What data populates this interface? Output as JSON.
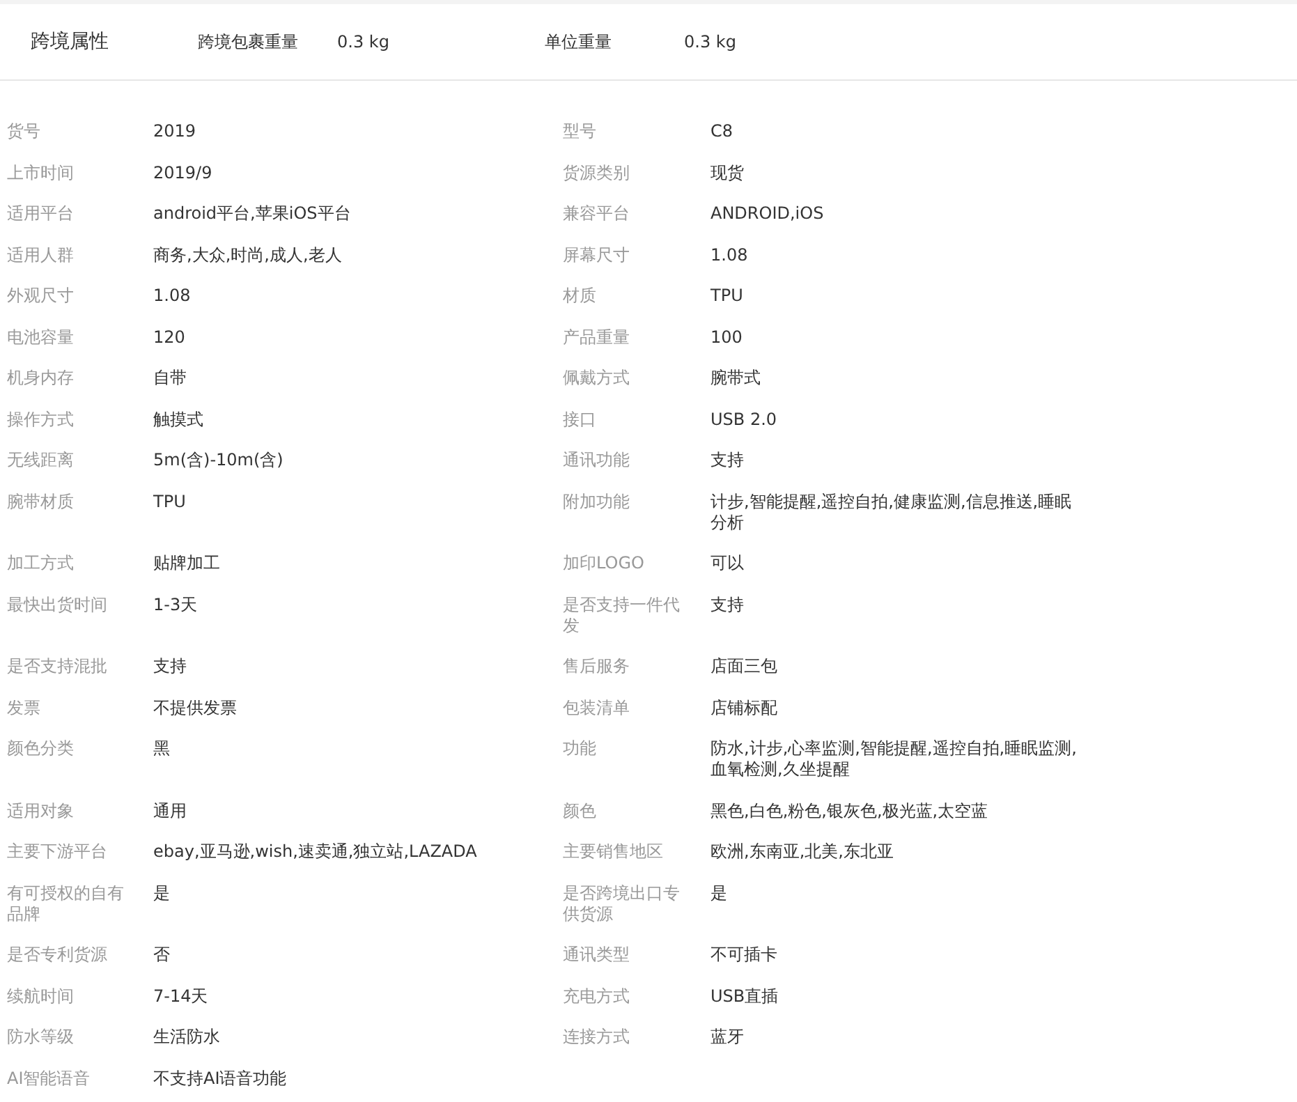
{
  "section": {
    "title": "跨境属性",
    "fields": [
      {
        "label": "跨境包裹重量",
        "value": "0.3 kg"
      },
      {
        "label": "单位重量",
        "value": "0.3 kg"
      }
    ]
  },
  "attributes": [
    {
      "left": {
        "label": "货号",
        "value": "2019"
      },
      "right": {
        "label": "型号",
        "value": "C8"
      }
    },
    {
      "left": {
        "label": "上市时间",
        "value": "2019/9"
      },
      "right": {
        "label": "货源类别",
        "value": "现货"
      }
    },
    {
      "left": {
        "label": "适用平台",
        "value": "android平台,苹果iOS平台"
      },
      "right": {
        "label": "兼容平台",
        "value": "ANDROID,iOS"
      }
    },
    {
      "left": {
        "label": "适用人群",
        "value": "商务,大众,时尚,成人,老人"
      },
      "right": {
        "label": "屏幕尺寸",
        "value": "1.08"
      }
    },
    {
      "left": {
        "label": "外观尺寸",
        "value": "1.08"
      },
      "right": {
        "label": "材质",
        "value": "TPU"
      }
    },
    {
      "left": {
        "label": "电池容量",
        "value": "120"
      },
      "right": {
        "label": "产品重量",
        "value": "100"
      }
    },
    {
      "left": {
        "label": "机身内存",
        "value": "自带"
      },
      "right": {
        "label": "佩戴方式",
        "value": "腕带式"
      }
    },
    {
      "left": {
        "label": "操作方式",
        "value": "触摸式"
      },
      "right": {
        "label": "接口",
        "value": "USB 2.0"
      }
    },
    {
      "left": {
        "label": "无线距离",
        "value": "5m(含)-10m(含)"
      },
      "right": {
        "label": "通讯功能",
        "value": "支持"
      }
    },
    {
      "left": {
        "label": "腕带材质",
        "value": "TPU"
      },
      "right": {
        "label": "附加功能",
        "value": "计步,智能提醒,遥控自拍,健康监测,信息推送,睡眠分析"
      }
    },
    {
      "left": {
        "label": "加工方式",
        "value": "贴牌加工"
      },
      "right": {
        "label": "加印LOGO",
        "value": "可以"
      }
    },
    {
      "left": {
        "label": "最快出货时间",
        "value": "1-3天"
      },
      "right": {
        "label": "是否支持一件代发",
        "value": "支持"
      }
    },
    {
      "left": {
        "label": "是否支持混批",
        "value": "支持"
      },
      "right": {
        "label": "售后服务",
        "value": "店面三包"
      }
    },
    {
      "left": {
        "label": "发票",
        "value": "不提供发票"
      },
      "right": {
        "label": "包装清单",
        "value": "店铺标配"
      }
    },
    {
      "left": {
        "label": "颜色分类",
        "value": "黑"
      },
      "right": {
        "label": "功能",
        "value": "防水,计步,心率监测,智能提醒,遥控自拍,睡眠监测,血氧检测,久坐提醒"
      }
    },
    {
      "left": {
        "label": "适用对象",
        "value": "通用"
      },
      "right": {
        "label": "颜色",
        "value": "黑色,白色,粉色,银灰色,极光蓝,太空蓝"
      }
    },
    {
      "left": {
        "label": "主要下游平台",
        "value": "ebay,亚马逊,wish,速卖通,独立站,LAZADA"
      },
      "right": {
        "label": "主要销售地区",
        "value": "欧洲,东南亚,北美,东北亚"
      }
    },
    {
      "left": {
        "label": "有可授权的自有品牌",
        "value": "是"
      },
      "right": {
        "label": "是否跨境出口专供货源",
        "value": "是"
      }
    },
    {
      "left": {
        "label": "是否专利货源",
        "value": "否"
      },
      "right": {
        "label": "通讯类型",
        "value": "不可插卡"
      }
    },
    {
      "left": {
        "label": "续航时间",
        "value": "7-14天"
      },
      "right": {
        "label": "充电方式",
        "value": "USB直插"
      }
    },
    {
      "left": {
        "label": "防水等级",
        "value": "生活防水"
      },
      "right": {
        "label": "连接方式",
        "value": "蓝牙"
      }
    },
    {
      "left": {
        "label": "AI智能语音",
        "value": "不支持AI语音功能"
      }
    }
  ]
}
